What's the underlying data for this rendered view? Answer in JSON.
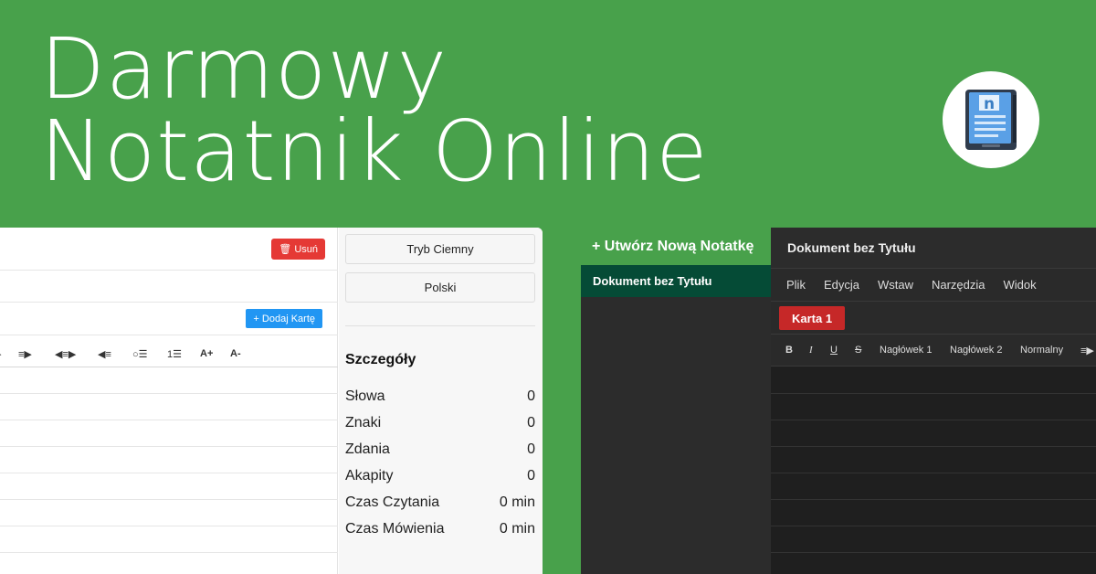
{
  "hero": {
    "line1": "Darmowy",
    "line2": "Notatnik Online"
  },
  "logo": {
    "icon": "notebook-app-icon"
  },
  "light_editor": {
    "delete_label": "🗑 Usuń",
    "add_tab_label": "+ Dodaj Kartę",
    "toolbar": [
      {
        "icon": "align-right-icon",
        "label": "≡▶"
      },
      {
        "icon": "align-center-icon",
        "label": "◀≡▶"
      },
      {
        "icon": "align-left-icon",
        "label": "◀≡"
      },
      {
        "icon": "bullet-list-icon",
        "label": "○☰"
      },
      {
        "icon": "numbered-list-icon",
        "label": "1☰"
      },
      {
        "icon": "font-increase-icon",
        "label": "A+"
      },
      {
        "icon": "font-decrease-icon",
        "label": "A-"
      }
    ]
  },
  "settings": {
    "dark_mode": "Tryb Ciemny",
    "language": "Polski",
    "details_title": "Szczegóły",
    "stats": [
      {
        "label": "Słowa",
        "value": "0"
      },
      {
        "label": "Znaki",
        "value": "0"
      },
      {
        "label": "Zdania",
        "value": "0"
      },
      {
        "label": "Akapity",
        "value": "0"
      },
      {
        "label": "Czas Czytania",
        "value": "0 min"
      },
      {
        "label": "Czas Mówienia",
        "value": "0 min"
      }
    ]
  },
  "dark_app": {
    "create_note": "+ Utwórz Nową Notatkę",
    "note_item": "Dokument bez Tytułu",
    "doc_title": "Dokument bez Tytułu",
    "menu": [
      "Plik",
      "Edycja",
      "Wstaw",
      "Narzędzia",
      "Widok"
    ],
    "tab": "Karta 1",
    "toolbar": [
      "B",
      "I",
      "U",
      "S",
      "Nagłówek 1",
      "Nagłówek 2",
      "Normalny",
      "≡▶"
    ]
  },
  "colors": {
    "background": "#48a14b",
    "delete": "#e53935",
    "add": "#2196f3",
    "tab": "#c62828",
    "selected_note": "#054b36"
  }
}
